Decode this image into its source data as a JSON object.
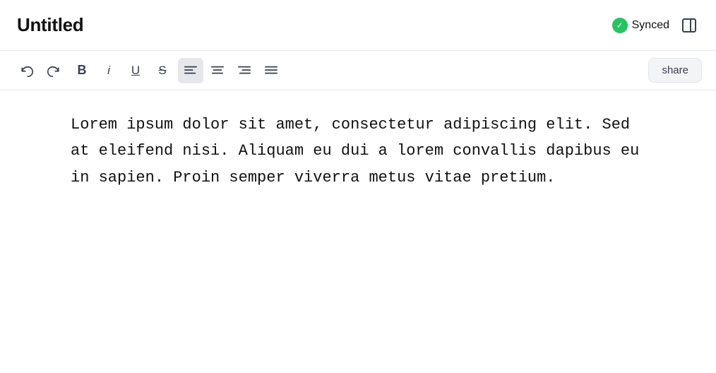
{
  "header": {
    "title": "Untitled",
    "synced_label": "Synced",
    "synced_icon": "✓"
  },
  "toolbar": {
    "undo_label": "↩",
    "redo_label": "↪",
    "bold_label": "B",
    "italic_label": "i",
    "underline_label": "U",
    "strikethrough_label": "S",
    "align_left_label": "align-left",
    "align_center_label": "align-center",
    "align_right_label": "align-right",
    "align_justify_label": "align-justify",
    "share_label": "share"
  },
  "content": {
    "text": "Lorem ipsum dolor sit amet, consectetur adipiscing elit. Sed at eleifend nisi. Aliquam eu dui a lorem convallis dapibus eu in sapien. Proin semper viverra metus vitae pretium."
  }
}
